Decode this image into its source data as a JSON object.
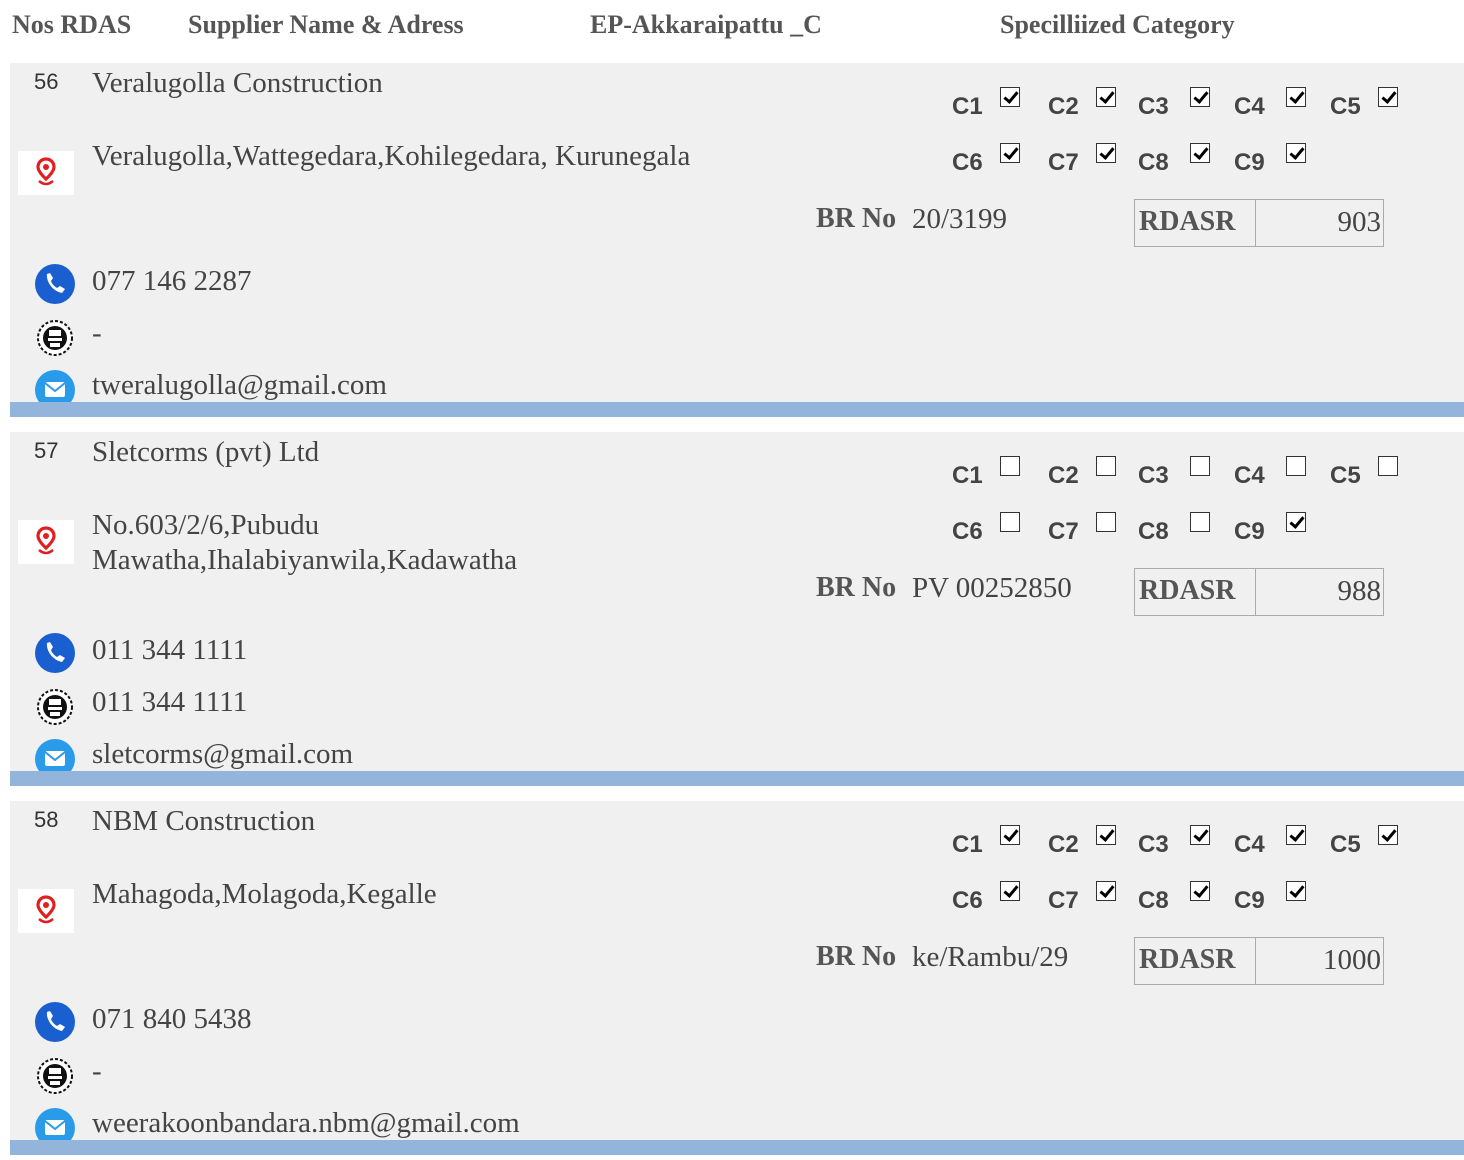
{
  "header": {
    "nos": "Nos RDAS",
    "supplier": "Supplier Name & Adress",
    "ep": "EP-Akkaraipattu _C",
    "category": "Specilliized Category"
  },
  "labels": {
    "br_no": "BR No",
    "rdasr": "RDASR"
  },
  "colors": {
    "separator": "#93b5dc",
    "row_bg": "#f0f0f0",
    "location_icon": "#e02020",
    "contact_icon": "#1a5fd0"
  },
  "icons": {
    "location": "map-pin-icon",
    "phone": "phone-icon",
    "fax": "fax-icon",
    "email": "email-icon"
  },
  "categories": [
    "C1",
    "C2",
    "C3",
    "C4",
    "C5",
    "C6",
    "C7",
    "C8",
    "C9"
  ],
  "records": [
    {
      "num": "56",
      "name": "Veralugolla Construction",
      "address": "Veralugolla,Wattegedara,Kohilegedara, Kurunegala",
      "phone": "077 146 2287",
      "fax": "-",
      "email": "tweralugolla@gmail.com",
      "br_no": "20/3199",
      "rdasr": "903",
      "checks": [
        true,
        true,
        true,
        true,
        true,
        true,
        true,
        true,
        true
      ]
    },
    {
      "num": "57",
      "name": "Sletcorms (pvt) Ltd",
      "address": "No.603/2/6,Pubudu Mawatha,Ihalabiyanwila,Kadawatha",
      "phone": "011 344 1111",
      "fax": "011 344 1111",
      "email": "sletcorms@gmail.com",
      "br_no": "PV 00252850",
      "rdasr": "988",
      "checks": [
        false,
        false,
        false,
        false,
        false,
        false,
        false,
        false,
        true
      ]
    },
    {
      "num": "58",
      "name": "NBM Construction",
      "address": "Mahagoda,Molagoda,Kegalle",
      "phone": "071 840 5438",
      "fax": "-",
      "email": "weerakoonbandara.nbm@gmail.com",
      "br_no": "ke/Rambu/29",
      "rdasr": "1000",
      "checks": [
        true,
        true,
        true,
        true,
        true,
        true,
        true,
        true,
        true
      ]
    }
  ]
}
